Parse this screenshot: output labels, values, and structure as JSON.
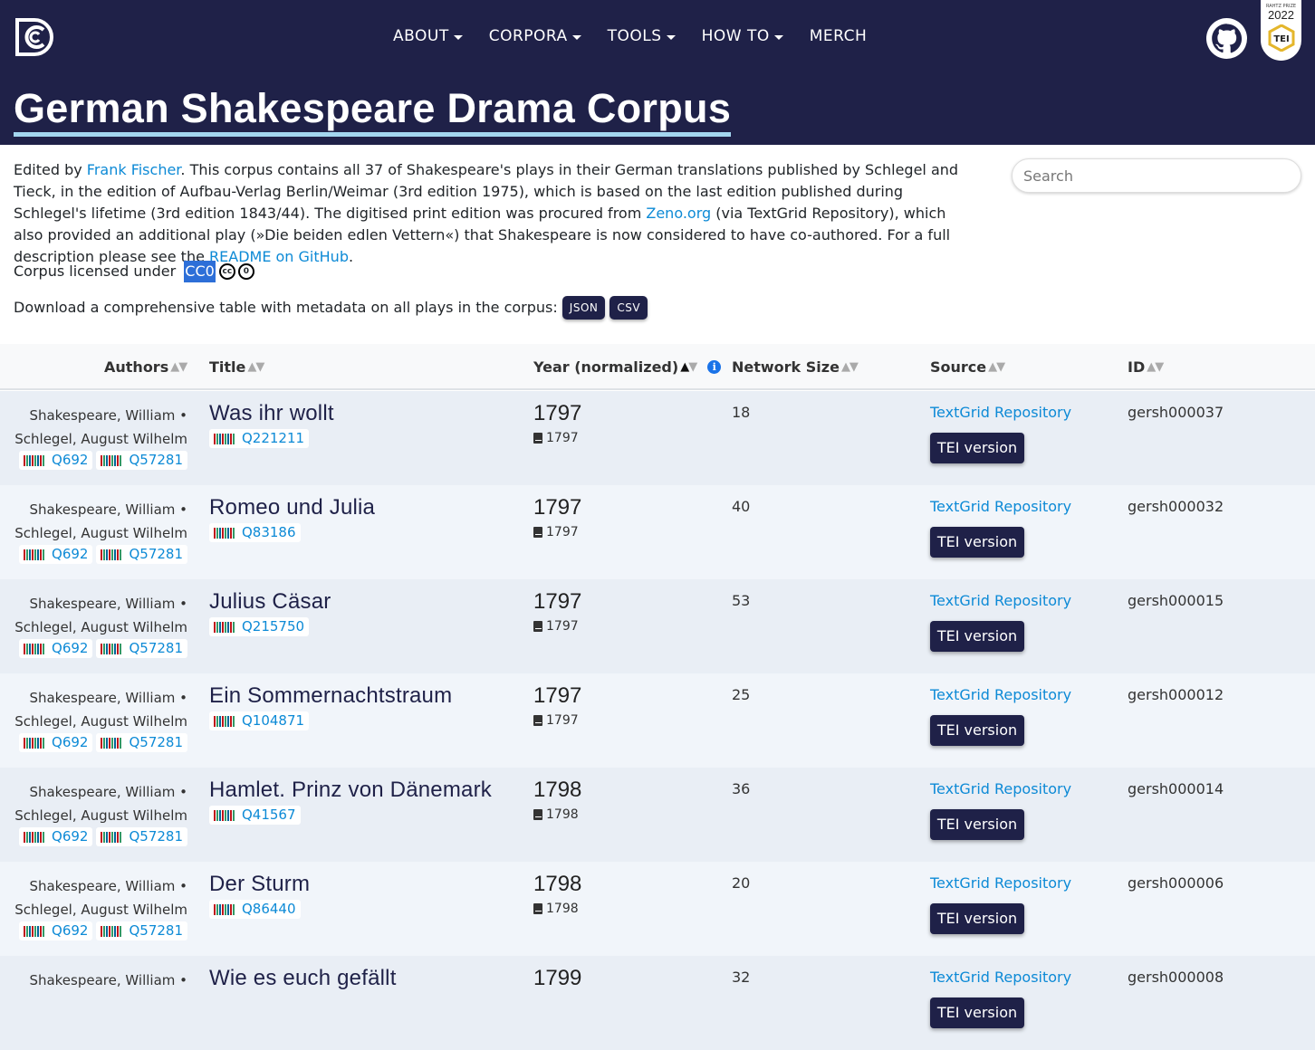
{
  "nav": {
    "items": [
      "ABOUT",
      "CORPORA",
      "TOOLS",
      "HOW TO"
    ],
    "merch": "MERCH"
  },
  "badge": {
    "small": "RAHTZ PRIZE",
    "year": "2022",
    "tei": "TEI"
  },
  "page_title": "German Shakespeare Drama Corpus",
  "intro": {
    "edited_by": "Edited by ",
    "editor": "Frank Fischer",
    "p1": ". This corpus contains all 37 of Shakespeare's plays in their German translations published by Schlegel and Tieck, in the edition of Aufbau-Verlag Berlin/Weimar (3rd edition 1975), which is based on the last edition published during Schlegel's lifetime (3rd edition 1843/44). The digitised print edition was procured from ",
    "zeno": "Zeno.org",
    "p2": " (via TextGrid Repository), which also provided an additional play (»Die beiden edlen Vettern«) that Shakespeare is now considered to have co-authored. For a full description please see the ",
    "readme": "README on GitHub",
    "p3": "."
  },
  "license": {
    "label": "Corpus licensed under ",
    "value": "CC0",
    "cc": "cc",
    "zero": "0"
  },
  "download": {
    "label": "Download a comprehensive table with metadata on all plays in the corpus:",
    "json": "JSON",
    "csv": "CSV"
  },
  "search": {
    "placeholder": "Search"
  },
  "table": {
    "headers": {
      "authors": "Authors",
      "title": "Title",
      "year": "Year (normalized)",
      "network": "Network Size",
      "source": "Source",
      "id": "ID"
    },
    "info": "i",
    "tei_label": "TEI version",
    "rows": [
      {
        "authors1": "Shakespeare, William •",
        "authors2": "Schlegel, August Wilhelm",
        "q1": "Q692",
        "q2": "Q57281",
        "title": "Was ihr wollt",
        "qid": "Q221211",
        "year": "1797",
        "year_print": "1797",
        "network": "18",
        "source": "TextGrid Repository",
        "id": "gersh000037"
      },
      {
        "authors1": "Shakespeare, William •",
        "authors2": "Schlegel, August Wilhelm",
        "q1": "Q692",
        "q2": "Q57281",
        "title": "Romeo und Julia",
        "qid": "Q83186",
        "year": "1797",
        "year_print": "1797",
        "network": "40",
        "source": "TextGrid Repository",
        "id": "gersh000032"
      },
      {
        "authors1": "Shakespeare, William •",
        "authors2": "Schlegel, August Wilhelm",
        "q1": "Q692",
        "q2": "Q57281",
        "title": "Julius Cäsar",
        "qid": "Q215750",
        "year": "1797",
        "year_print": "1797",
        "network": "53",
        "source": "TextGrid Repository",
        "id": "gersh000015"
      },
      {
        "authors1": "Shakespeare, William •",
        "authors2": "Schlegel, August Wilhelm",
        "q1": "Q692",
        "q2": "Q57281",
        "title": "Ein Sommernachtstraum",
        "qid": "Q104871",
        "year": "1797",
        "year_print": "1797",
        "network": "25",
        "source": "TextGrid Repository",
        "id": "gersh000012"
      },
      {
        "authors1": "Shakespeare, William •",
        "authors2": "Schlegel, August Wilhelm",
        "q1": "Q692",
        "q2": "Q57281",
        "title": "Hamlet. Prinz von Dänemark",
        "qid": "Q41567",
        "year": "1798",
        "year_print": "1798",
        "network": "36",
        "source": "TextGrid Repository",
        "id": "gersh000014"
      },
      {
        "authors1": "Shakespeare, William •",
        "authors2": "Schlegel, August Wilhelm",
        "q1": "Q692",
        "q2": "Q57281",
        "title": "Der Sturm",
        "qid": "Q86440",
        "year": "1798",
        "year_print": "1798",
        "network": "20",
        "source": "TextGrid Repository",
        "id": "gersh000006"
      },
      {
        "authors1": "Shakespeare, William •",
        "authors2": "",
        "q1": "",
        "q2": "",
        "title": "Wie es euch gefällt",
        "qid": "",
        "year": "1799",
        "year_print": "",
        "network": "32",
        "source": "TextGrid Repository",
        "id": "gersh000008"
      }
    ]
  }
}
